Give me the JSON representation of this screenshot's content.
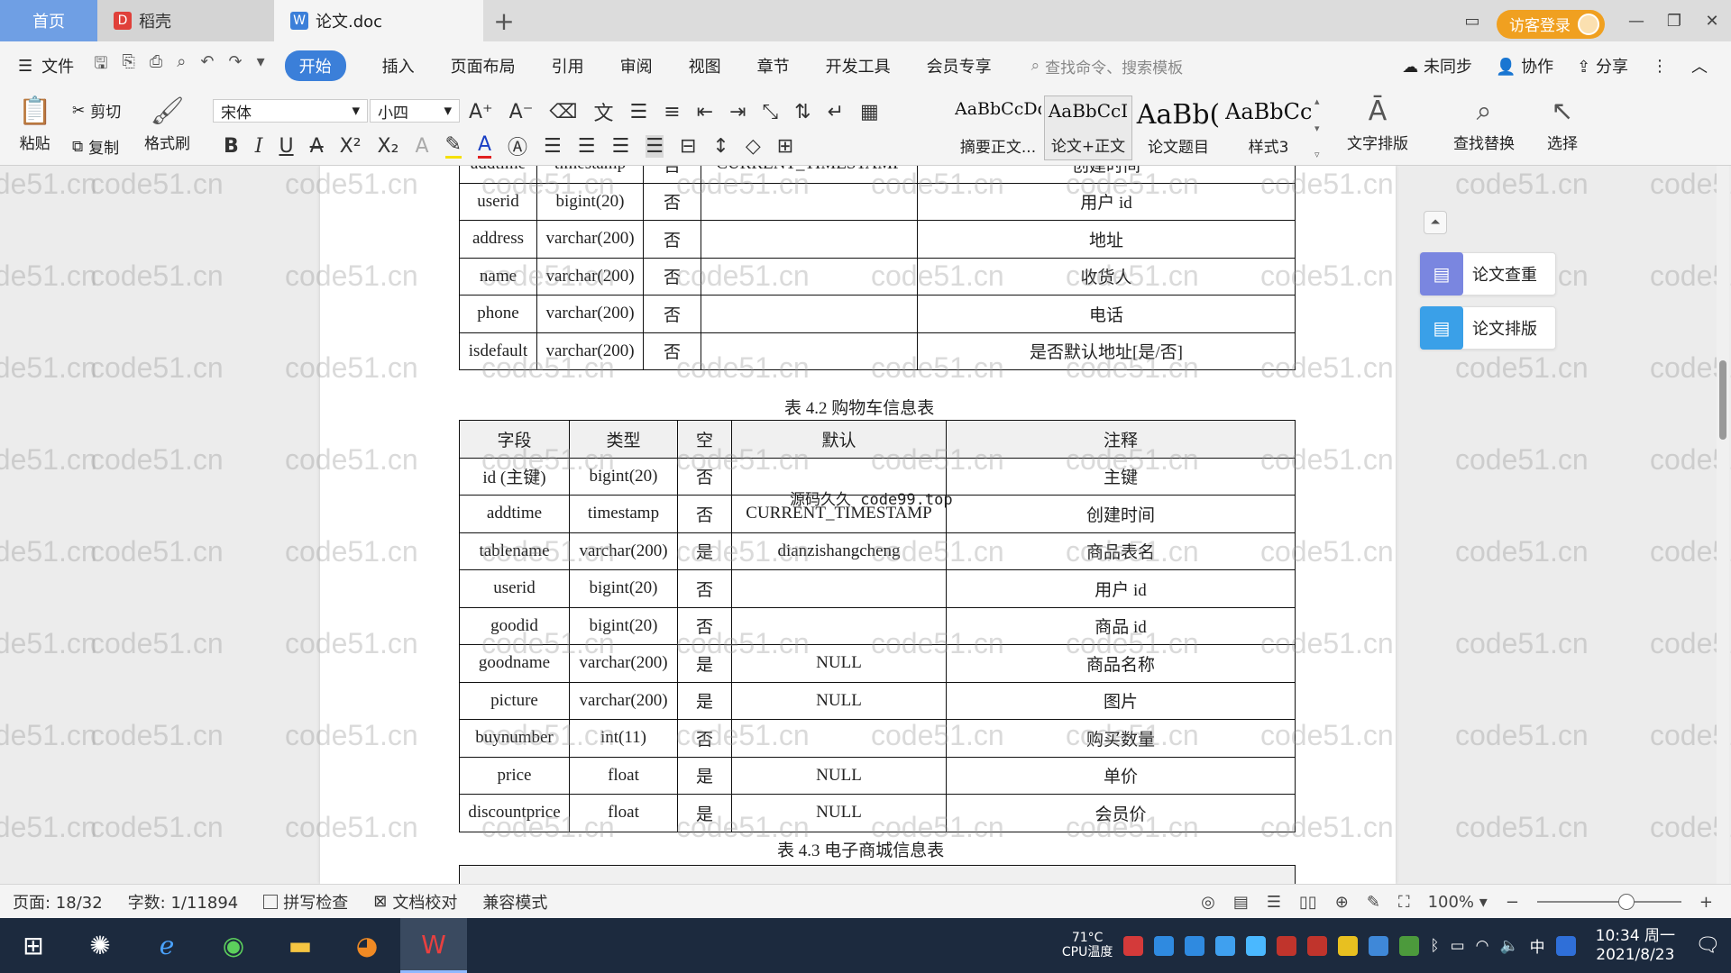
{
  "tabs": {
    "home": "首页",
    "daoke": "稻壳",
    "doc": "论文.doc",
    "new_tab": "+"
  },
  "titlebar": {
    "login": "访客登录"
  },
  "menu": {
    "file": "文件",
    "items": [
      "开始",
      "插入",
      "页面布局",
      "引用",
      "审阅",
      "视图",
      "章节",
      "开发工具",
      "会员专享"
    ],
    "search_placeholder": "查找命令、搜索模板",
    "right": [
      "未同步",
      "协作",
      "分享"
    ]
  },
  "ribbon": {
    "paste": "粘贴",
    "cut": "剪切",
    "copy": "复制",
    "format_painter": "格式刷",
    "font_name": "宋体",
    "font_size": "小四",
    "styles": [
      {
        "preview": "AaBbCcDd",
        "label": "摘要正文..."
      },
      {
        "preview": "AaBbCcI",
        "label": "论文+正文"
      },
      {
        "preview": "AaBb(",
        "label": "论文题目"
      },
      {
        "preview": "AaBbCc",
        "label": "样式3"
      }
    ],
    "text_layout": "文字排版",
    "find_replace": "查找替换",
    "select": "选择"
  },
  "table_top": {
    "rows": [
      [
        "addtime",
        "timestamp",
        "否",
        "CURRENT_TIMESTAMP",
        "创建时间"
      ],
      [
        "userid",
        "bigint(20)",
        "否",
        "",
        "用户 id"
      ],
      [
        "address",
        "varchar(200)",
        "否",
        "",
        "地址"
      ],
      [
        "name",
        "varchar(200)",
        "否",
        "",
        "收货人"
      ],
      [
        "phone",
        "varchar(200)",
        "否",
        "",
        "电话"
      ],
      [
        "isdefault",
        "varchar(200)",
        "否",
        "",
        "是否默认地址[是/否]"
      ]
    ]
  },
  "caption_42": "表 4.2 购物车信息表",
  "table_cart": {
    "headers": [
      "字段",
      "类型",
      "空",
      "默认",
      "注释"
    ],
    "rows": [
      [
        "id (主键)",
        "bigint(20)",
        "否",
        "",
        "主键"
      ],
      [
        "addtime",
        "timestamp",
        "否",
        "CURRENT_TIMESTAMP",
        "创建时间"
      ],
      [
        "tablename",
        "varchar(200)",
        "是",
        "dianzishangcheng",
        "商品表名"
      ],
      [
        "userid",
        "bigint(20)",
        "否",
        "",
        "用户 id"
      ],
      [
        "goodid",
        "bigint(20)",
        "否",
        "",
        "商品 id"
      ],
      [
        "goodname",
        "varchar(200)",
        "是",
        "NULL",
        "商品名称"
      ],
      [
        "picture",
        "varchar(200)",
        "是",
        "NULL",
        "图片"
      ],
      [
        "buynumber",
        "int(11)",
        "否",
        "",
        "购买数量"
      ],
      [
        "price",
        "float",
        "是",
        "NULL",
        "单价"
      ],
      [
        "discountprice",
        "float",
        "是",
        "NULL",
        "会员价"
      ]
    ]
  },
  "overlay_stamp": "源码久久 code99.top",
  "caption_43": "表 4.3 电子商城信息表",
  "watermark_text": "code51.cn",
  "right_panel": {
    "check": "论文查重",
    "layout": "论文排版"
  },
  "status": {
    "page": "页面: 18/32",
    "words": "字数: 1/11894",
    "spell": "拼写检查",
    "proof": "文档校对",
    "compat": "兼容模式",
    "zoom": "100%",
    "zoom_level": 0.62
  },
  "taskbar": {
    "temp": "71°C",
    "temp_label": "CPU温度",
    "ime": "中",
    "time": "10:34 周一",
    "date": "2021/8/23"
  },
  "colors": {
    "accent": "#3b7fd9",
    "home_tab": "#6f9fe4",
    "login": "#f0a020",
    "taskbar": "#1c2a3e"
  }
}
